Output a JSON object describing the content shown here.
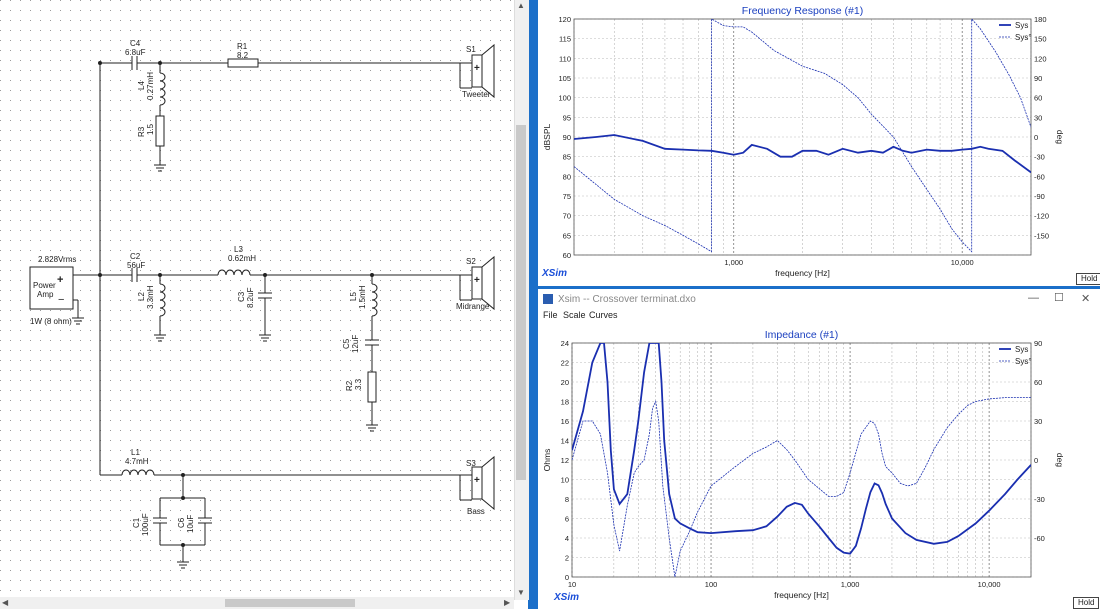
{
  "schematic": {
    "source": {
      "voltage": "2.828Vrms",
      "name_line1": "Power",
      "name_line2": "Amp",
      "load": "1W (8 ohm)"
    },
    "components": {
      "C4": {
        "name": "C4",
        "value": "6.8uF"
      },
      "R1": {
        "name": "R1",
        "value": "8.2"
      },
      "L4": {
        "name": "L4",
        "value": "0.27mH"
      },
      "R3": {
        "name": "R3",
        "value": "1.5"
      },
      "C2": {
        "name": "C2",
        "value": "56uF"
      },
      "L3": {
        "name": "L3",
        "value": "0.62mH"
      },
      "L2": {
        "name": "L2",
        "value": "3.3mH"
      },
      "C3": {
        "name": "C3",
        "value": "8.2uF"
      },
      "L5": {
        "name": "L5",
        "value": "1.5mH"
      },
      "C5": {
        "name": "C5",
        "value": "12uF"
      },
      "R2": {
        "name": "R2",
        "value": "3.3"
      },
      "L1": {
        "name": "L1",
        "value": "4.7mH"
      },
      "C1": {
        "name": "C1",
        "value": "100uF"
      },
      "C6": {
        "name": "C6",
        "value": "10uF"
      }
    },
    "speakers": {
      "S1": {
        "name": "S1",
        "label": "Tweeter"
      },
      "S2": {
        "name": "S2",
        "label": "Midrange"
      },
      "S3": {
        "name": "S3",
        "label": "Bass"
      }
    }
  },
  "freq_window": {
    "hold_label": "Hold",
    "brand": "XSim",
    "chart_data": {
      "type": "line",
      "title": "Frequency Response (#1)",
      "xlabel": "frequency [Hz]",
      "ylabel": "dBSPL",
      "y2label": "deg",
      "x_scale": "log",
      "xlim": [
        200,
        20000
      ],
      "ylim": [
        60,
        120
      ],
      "y2lim": [
        -180,
        180
      ],
      "x_tick_labels": [
        "1,000",
        "10,000"
      ],
      "y_ticks": [
        "120",
        "115",
        "110",
        "105",
        "100",
        "95",
        "90",
        "85",
        "80",
        "75",
        "70",
        "65",
        "60"
      ],
      "y2_ticks": [
        "180",
        "150",
        "120",
        "90",
        "60",
        "30",
        "0",
        "-30",
        "-60",
        "-90",
        "-120",
        "-150"
      ],
      "legend": [
        "Sys",
        "Sys°"
      ],
      "legend_position": "top-right",
      "series": [
        {
          "name": "Sys",
          "axis": "left",
          "x": [
            200,
            250,
            300,
            400,
            500,
            600,
            700,
            800,
            900,
            1000,
            1100,
            1200,
            1400,
            1600,
            1800,
            2000,
            2300,
            2600,
            3000,
            3500,
            4000,
            4500,
            5000,
            5500,
            6000,
            7000,
            8000,
            9000,
            10000,
            11000,
            12000,
            13000,
            15000,
            17000,
            20000
          ],
          "y": [
            89.5,
            90,
            90.5,
            89,
            87,
            86.8,
            86.6,
            86.5,
            86,
            85.5,
            86,
            88,
            87,
            85,
            85,
            86.5,
            86.5,
            85.5,
            87,
            86,
            86.5,
            86,
            87.5,
            86.5,
            86,
            86.8,
            86.5,
            86.5,
            86.8,
            87,
            87.5,
            87,
            86.5,
            84,
            81
          ]
        },
        {
          "name": "Sys°",
          "axis": "right",
          "x": [
            200,
            300,
            400,
            500,
            600,
            700,
            800,
            800,
            900,
            1000,
            1100,
            1200,
            1500,
            2000,
            2500,
            3000,
            3500,
            4000,
            5000,
            6000,
            7000,
            8000,
            9000,
            10000,
            11000,
            11000,
            12000,
            14000,
            16000,
            18000,
            20000
          ],
          "y": [
            -45,
            -95,
            -120,
            -135,
            -150,
            -163,
            -175,
            180,
            170,
            168,
            168,
            160,
            132,
            108,
            97,
            80,
            60,
            35,
            0,
            -45,
            -80,
            -110,
            -140,
            -160,
            -175,
            180,
            165,
            130,
            95,
            60,
            15
          ]
        }
      ]
    }
  },
  "imp_window": {
    "title": "Xsim -- Crossover terminat.dxo",
    "menu": [
      "File",
      "Scale",
      "Curves"
    ],
    "hold_label": "Hold",
    "brand": "XSim",
    "chart_data": {
      "type": "line",
      "title": "Impedance (#1)",
      "xlabel": "frequency [Hz]",
      "ylabel": "Ohms",
      "y2label": "deg",
      "x_scale": "log",
      "xlim": [
        10,
        20000
      ],
      "ylim": [
        0,
        24
      ],
      "y2lim": [
        -90,
        90
      ],
      "x_tick_labels": [
        "10",
        "100",
        "1,000",
        "10,000"
      ],
      "y_ticks": [
        "24",
        "22",
        "20",
        "18",
        "16",
        "14",
        "12",
        "10",
        "8",
        "6",
        "4",
        "2",
        "0"
      ],
      "y2_ticks": [
        "90",
        "60",
        "30",
        "0",
        "-30",
        "-60"
      ],
      "legend": [
        "Sys",
        "Sys°"
      ],
      "legend_position": "top-right",
      "series": [
        {
          "name": "Sys",
          "axis": "left",
          "x": [
            10,
            12,
            14,
            16,
            17,
            18,
            19,
            20,
            22,
            25,
            28,
            30,
            33,
            36,
            38,
            40,
            42,
            44,
            46,
            50,
            55,
            60,
            70,
            80,
            100,
            150,
            200,
            250,
            300,
            350,
            400,
            450,
            500,
            600,
            700,
            800,
            900,
            1000,
            1100,
            1200,
            1300,
            1400,
            1500,
            1600,
            1700,
            1800,
            2000,
            2500,
            3000,
            4000,
            5000,
            6000,
            8000,
            10000,
            13000,
            16000,
            20000
          ],
          "y": [
            13,
            17,
            22,
            24,
            24,
            20,
            13,
            9,
            7.5,
            8.5,
            13,
            16,
            21,
            24,
            24,
            24,
            24,
            20,
            14,
            8.5,
            6,
            5.5,
            5,
            4.6,
            4.5,
            4.7,
            4.8,
            5.2,
            6.2,
            7.2,
            7.6,
            7.4,
            6.5,
            5.2,
            4,
            3,
            2.5,
            2.4,
            3.2,
            5,
            7,
            8.7,
            9.6,
            9.4,
            8.6,
            7.5,
            6,
            4.5,
            3.8,
            3.4,
            3.6,
            4.2,
            5.5,
            6.8,
            8.5,
            10,
            11.5
          ]
        },
        {
          "name": "Sys°",
          "axis": "right",
          "x": [
            10,
            12,
            14,
            16,
            18,
            20,
            22,
            25,
            28,
            30,
            33,
            36,
            38,
            40,
            42,
            45,
            50,
            55,
            60,
            70,
            80,
            100,
            150,
            200,
            250,
            300,
            350,
            400,
            500,
            600,
            700,
            800,
            900,
            1000,
            1200,
            1400,
            1500,
            1600,
            1700,
            1800,
            2000,
            2300,
            2600,
            3000,
            3500,
            4000,
            5000,
            6000,
            7000,
            8000,
            10000,
            13000,
            16000,
            20000
          ],
          "y": [
            0,
            30,
            30,
            20,
            -10,
            -50,
            -70,
            -35,
            -10,
            -5,
            0,
            20,
            40,
            45,
            30,
            -20,
            -60,
            -90,
            -70,
            -55,
            -40,
            -20,
            -5,
            5,
            10,
            15,
            8,
            0,
            -15,
            -22,
            -28,
            -28,
            -25,
            -10,
            20,
            30,
            28,
            20,
            5,
            -5,
            -10,
            -18,
            -20,
            -18,
            -5,
            8,
            25,
            35,
            42,
            45,
            47,
            48,
            48,
            48
          ]
        }
      ]
    }
  }
}
